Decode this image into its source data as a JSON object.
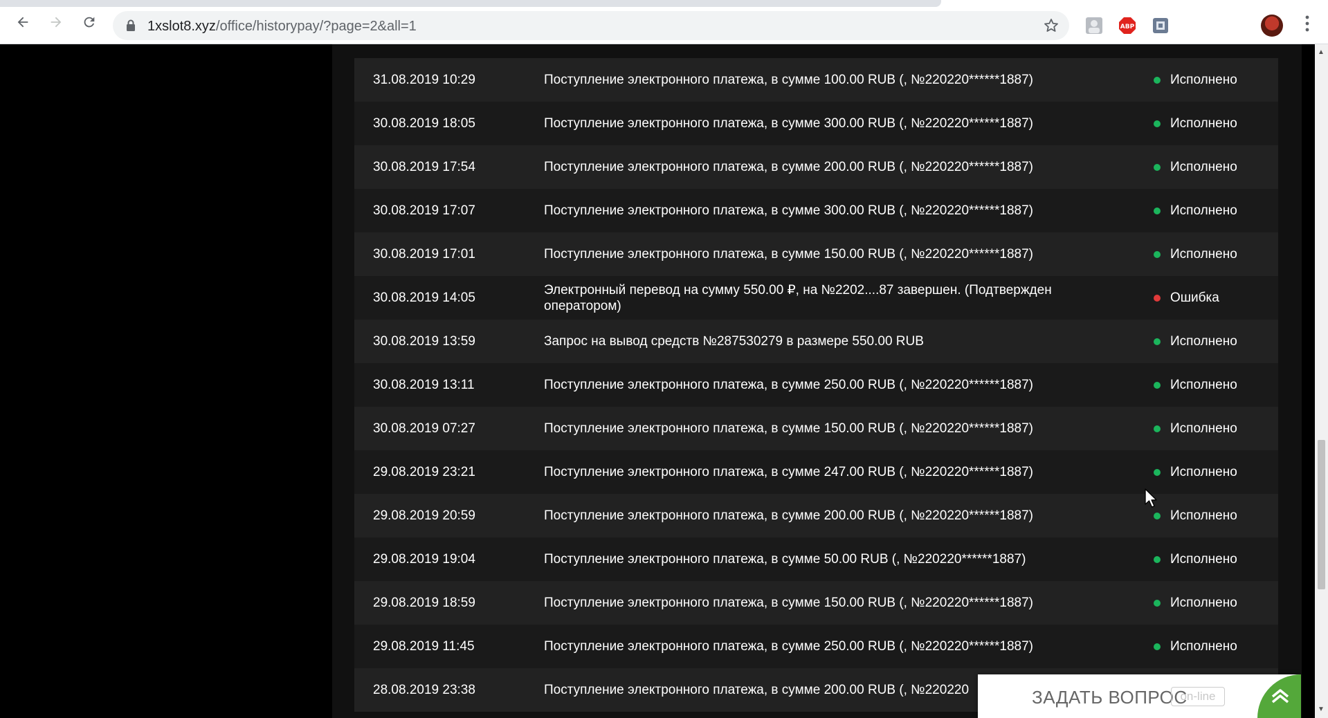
{
  "browser": {
    "url_domain": "1xslot8.xyz",
    "url_path": "/office/historypay/?page=2&all=1"
  },
  "colors": {
    "status_ok": "#1bb55c",
    "status_error": "#e03a3a",
    "chat_accent": "#54a83a"
  },
  "rows": [
    {
      "date": "31.08.2019 10:29",
      "desc": "Поступление электронного платежа, в сумме 100.00 RUB (, №220220******1887)",
      "status": "Исполнено",
      "state": "ok"
    },
    {
      "date": "30.08.2019 18:05",
      "desc": "Поступление электронного платежа, в сумме 300.00 RUB (, №220220******1887)",
      "status": "Исполнено",
      "state": "ok"
    },
    {
      "date": "30.08.2019 17:54",
      "desc": "Поступление электронного платежа, в сумме 200.00 RUB (, №220220******1887)",
      "status": "Исполнено",
      "state": "ok"
    },
    {
      "date": "30.08.2019 17:07",
      "desc": "Поступление электронного платежа, в сумме 300.00 RUB (, №220220******1887)",
      "status": "Исполнено",
      "state": "ok"
    },
    {
      "date": "30.08.2019 17:01",
      "desc": "Поступление электронного платежа, в сумме 150.00 RUB (, №220220******1887)",
      "status": "Исполнено",
      "state": "ok"
    },
    {
      "date": "30.08.2019 14:05",
      "desc": "Электронный перевод на сумму 550.00 ₽, на №2202....87 завершен. (Подтвержден оператором)",
      "status": "Ошибка",
      "state": "error"
    },
    {
      "date": "30.08.2019 13:59",
      "desc": "Запрос на вывод средств №287530279 в размере 550.00 RUB",
      "status": "Исполнено",
      "state": "ok"
    },
    {
      "date": "30.08.2019 13:11",
      "desc": "Поступление электронного платежа, в сумме 250.00 RUB (, №220220******1887)",
      "status": "Исполнено",
      "state": "ok"
    },
    {
      "date": "30.08.2019 07:27",
      "desc": "Поступление электронного платежа, в сумме 150.00 RUB (, №220220******1887)",
      "status": "Исполнено",
      "state": "ok"
    },
    {
      "date": "29.08.2019 23:21",
      "desc": "Поступление электронного платежа, в сумме 247.00 RUB (, №220220******1887)",
      "status": "Исполнено",
      "state": "ok"
    },
    {
      "date": "29.08.2019 20:59",
      "desc": "Поступление электронного платежа, в сумме 200.00 RUB (, №220220******1887)",
      "status": "Исполнено",
      "state": "ok"
    },
    {
      "date": "29.08.2019 19:04",
      "desc": "Поступление электронного платежа, в сумме 50.00 RUB (, №220220******1887)",
      "status": "Исполнено",
      "state": "ok"
    },
    {
      "date": "29.08.2019 18:59",
      "desc": "Поступление электронного платежа, в сумме 150.00 RUB (, №220220******1887)",
      "status": "Исполнено",
      "state": "ok"
    },
    {
      "date": "29.08.2019 11:45",
      "desc": "Поступление электронного платежа, в сумме 250.00 RUB (, №220220******1887)",
      "status": "Исполнено",
      "state": "ok"
    },
    {
      "date": "28.08.2019 23:38",
      "desc": "Поступление электронного платежа, в сумме 200.00 RUB (, №220220",
      "status": "",
      "state": "ok"
    }
  ],
  "chat": {
    "label": "ЗАДАТЬ ВОПРОС",
    "online_badge": "on-line"
  }
}
